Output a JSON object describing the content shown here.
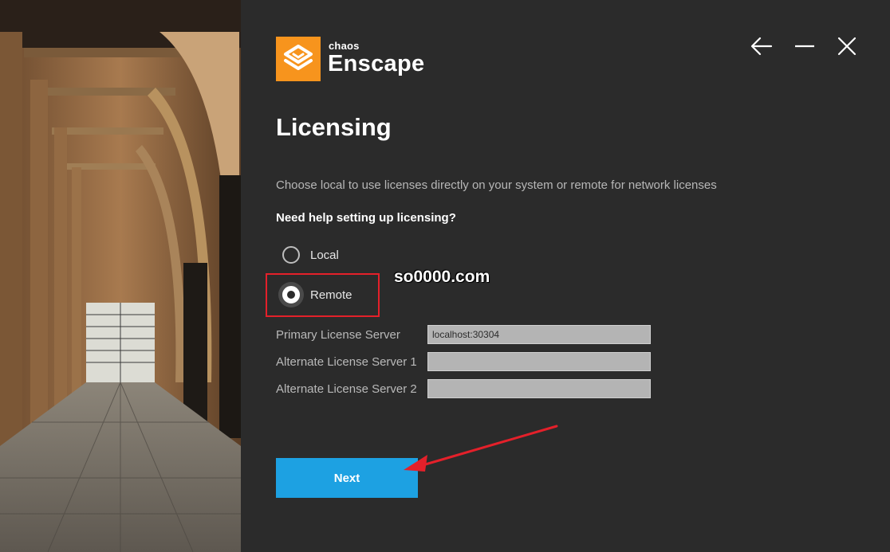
{
  "brand": {
    "company": "chaos",
    "product": "Enscape",
    "accent_color": "#f7941d"
  },
  "window_controls": {
    "back_icon": "arrow-left-icon",
    "minimize_icon": "minimize-icon",
    "close_icon": "close-icon"
  },
  "page": {
    "title": "Licensing",
    "description": "Choose local to use licenses directly on your system or remote for network licenses",
    "help_link": "Need help setting up licensing?"
  },
  "license_mode": {
    "options": [
      {
        "label": "Local",
        "selected": false
      },
      {
        "label": "Remote",
        "selected": true
      }
    ]
  },
  "servers": {
    "primary": {
      "label": "Primary License Server",
      "value": "localhost:30304"
    },
    "alternate1": {
      "label": "Alternate License Server 1",
      "value": ""
    },
    "alternate2": {
      "label": "Alternate License Server 2",
      "value": ""
    }
  },
  "actions": {
    "next_label": "Next",
    "button_color": "#1da1e2"
  },
  "overlay": {
    "watermark": "so0000.com",
    "highlight_color": "#e4202a"
  }
}
